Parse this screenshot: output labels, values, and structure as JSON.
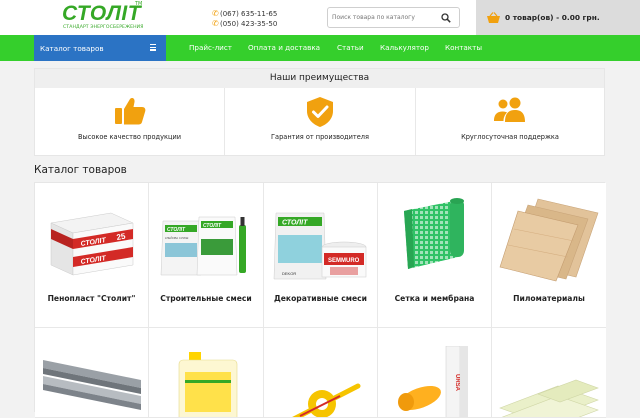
{
  "header": {
    "logo": {
      "word": "СТОЛІТ",
      "tm": "TM",
      "tagline": "СТАНДАРТ ЭНЕРГОСБЕРЕЖЕНИЯ"
    },
    "phones": [
      "(067) 635-11-65",
      "(050) 423-35-50"
    ],
    "search": {
      "placeholder": "Поиск товара по каталогу",
      "icon": "search-icon"
    },
    "cart": {
      "text": "0 товар(ов) - 0.00 грн.",
      "icon": "basket-icon"
    }
  },
  "nav": {
    "catalog_label": "Каталог товаров",
    "items": [
      "Прайс-лист",
      "Оплата и доставка",
      "Статьи",
      "Калькулятор",
      "Контакты"
    ]
  },
  "advantages": {
    "title": "Наши преимущества",
    "items": [
      {
        "label": "Высокое качество продукции",
        "icon": "thumbs-up-icon"
      },
      {
        "label": "Гарантия от производителя",
        "icon": "shield-check-icon"
      },
      {
        "label": "Круглосуточная поддержка",
        "icon": "users-icon"
      }
    ]
  },
  "catalog": {
    "title": "Каталог товаров",
    "products": [
      {
        "label": "Пенопласт \"Столит\""
      },
      {
        "label": "Строительные смеси"
      },
      {
        "label": "Декоративные смеси"
      },
      {
        "label": "Сетка и мембрана"
      },
      {
        "label": "Пиломатериалы"
      },
      {
        "label": ""
      },
      {
        "label": ""
      },
      {
        "label": ""
      },
      {
        "label": ""
      },
      {
        "label": ""
      }
    ],
    "image_text": {
      "brand": "СТОЛІТ",
      "grade": "25",
      "klei": "КЛЕЙОВА СУМІШ",
      "dekor": "DEKOR",
      "semmuro": "SEMMURO",
      "urs": "URSA"
    }
  },
  "colors": {
    "green": "#35cf2c",
    "brand_green": "#35a826",
    "blue": "#2b73c4",
    "orange": "#f1a10f",
    "red": "#d32a26"
  }
}
